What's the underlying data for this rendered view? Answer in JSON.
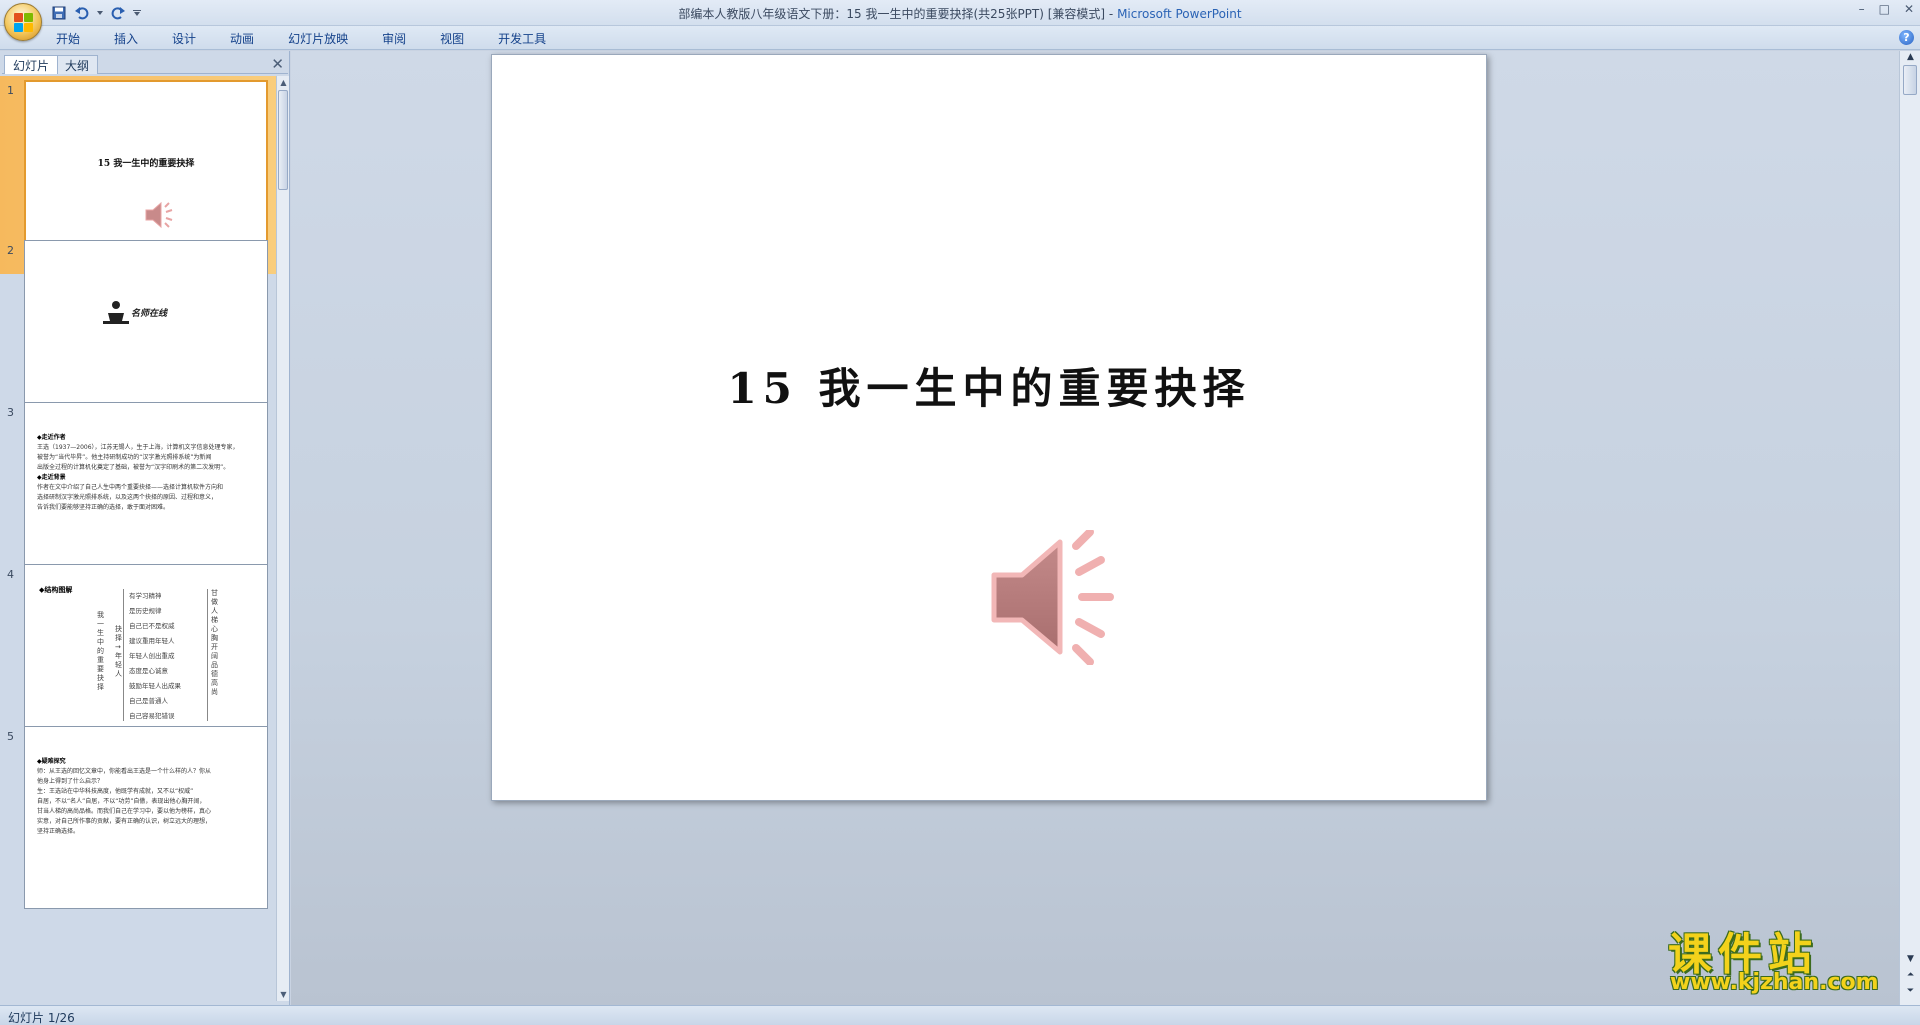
{
  "window": {
    "title": "部编本人教版八年级语文下册：15   我一生中的重要抉择(共25张PPT) [兼容模式] - ",
    "app_name": "Microsoft PowerPoint",
    "minimize": "–",
    "maximize": "□",
    "close": "✕"
  },
  "ribbon": {
    "tabs": [
      "开始",
      "插入",
      "设计",
      "动画",
      "幻灯片放映",
      "审阅",
      "视图",
      "开发工具"
    ]
  },
  "panel": {
    "tabs": [
      "幻灯片",
      "大纲"
    ],
    "close": "✕"
  },
  "thumbnails": [
    {
      "number": "1",
      "title": "15   我一生中的重要抉择"
    },
    {
      "number": "2",
      "logo_text": "名师在线"
    },
    {
      "number": "3",
      "lines": [
        "◆走近作者",
        "王选（1937—2006），江苏无锡人，生于上海，计算机文字信息处理专家，",
        "被誉为“当代毕昇”。他主持研制成功的“汉字激光照排系统”为新闻",
        "出版全过程的计算机化奠定了基础，被誉为“汉字印刷术的第二次发明”。",
        "◆走近背景",
        "作者在文中介绍了自己人生中两个重要抉择——选择计算机软件方向和",
        "选择研制汉字激光照排系统，以及这两个抉择的原因、过程和意义，",
        "告诉我们要能够坚持正确的选择，敢于面对困难。"
      ]
    },
    {
      "number": "4",
      "heading": "◆结构图解",
      "left_col": "我一生中的重要抉择",
      "mid_col": "抉择→年轻人",
      "items": [
        "有学习精神",
        "是历史规律",
        "自己已不是权威",
        "建议重用年轻人",
        "年轻人创出重成",
        "态度是心诚意",
        "鼓励年轻人出成果",
        "自己是普通人",
        "自己容易犯错误"
      ],
      "right_col": "甘做人梯  心胸开阔  品德高尚"
    },
    {
      "number": "5",
      "lines": [
        "◆疑难探究",
        "师：从王选的回忆文章中，你能看出王选是一个什么样的人？你从",
        "他身上得到了什么启示？",
        "生：王选站在中华科技高度，他既学有成就，又不以“权威”",
        "自居，不以“名人”自居，不以“功劳”自傲，表现出他心胸开阔，",
        "甘当人梯的高尚品格。而我们自己在学习中，要以他为榜样，真心",
        "实意，对自己所作事的贡献，要有正确的认识，树立远大的理想，",
        "坚持正确选择。"
      ]
    }
  ],
  "slide": {
    "title": "15   我一生中的重要抉择",
    "audio_icon": "speaker-icon"
  },
  "watermark": {
    "title": "课件站",
    "url": "www.kjzhan.com"
  },
  "status": {
    "slide_indicator": "幻灯片 1/26"
  }
}
